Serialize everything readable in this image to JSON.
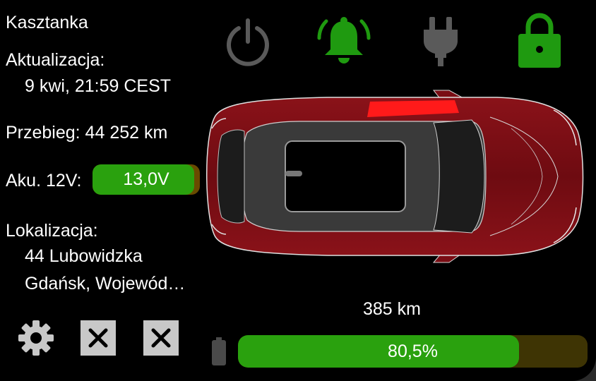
{
  "vehicle": {
    "name": "Kasztanka"
  },
  "update": {
    "label": "Aktualizacja:",
    "value": "9 kwi, 21:59 CEST"
  },
  "odometer": {
    "text": "Przebieg: 44 252 km"
  },
  "battery12v": {
    "label": "Aku. 12V:",
    "value": "13,0V",
    "fill_fraction": 0.95,
    "fill_color": "#2aa10e",
    "track_color": "#6a4a00"
  },
  "location": {
    "label": "Lokalizacja:",
    "line1": "44 Lubowidzka",
    "line2": "Gdańsk, Wojewód…"
  },
  "status_icons": [
    {
      "name": "power-icon",
      "color": "#5a5a5a"
    },
    {
      "name": "bell-icon",
      "color": "#1f9a10"
    },
    {
      "name": "plug-icon",
      "color": "#5a5a5a"
    },
    {
      "name": "lock-icon",
      "color": "#1f9a10"
    }
  ],
  "car": {
    "body_color": "#7a0d14",
    "highlight_color": "#ff1a1a"
  },
  "range": {
    "text": "385 km"
  },
  "main_battery": {
    "value": "80,5%",
    "fill_fraction": 0.805,
    "fill_color": "#2aa10e",
    "track_color": "#3e3404"
  },
  "bottom_icons": [
    {
      "name": "settings-icon"
    },
    {
      "name": "close-icon"
    },
    {
      "name": "close-icon"
    }
  ]
}
